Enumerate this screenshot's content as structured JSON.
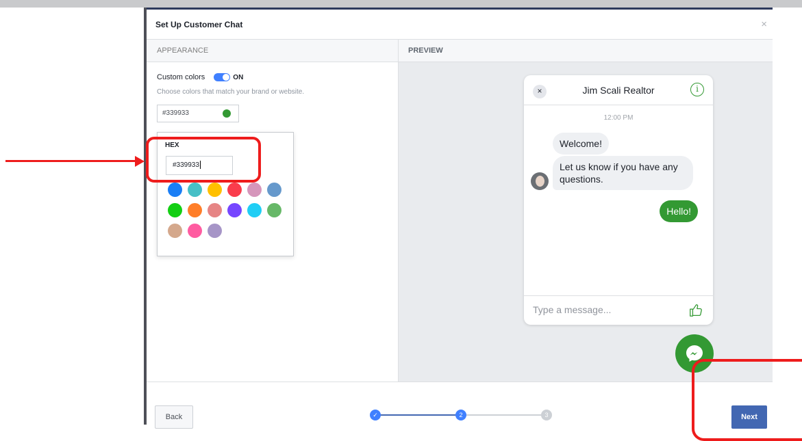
{
  "dialog": {
    "title": "Set Up Customer Chat",
    "close_glyph": "×"
  },
  "appearance": {
    "section_label": "APPEARANCE",
    "custom_colors_label": "Custom colors",
    "toggle_state": "ON",
    "help_text": "Choose colors that match your brand or website.",
    "selected_color_value": "#339933",
    "selected_color": "#339933",
    "picker": {
      "hex_label": "HEX",
      "hex_value": "#339933",
      "swatches": [
        "#1a7ef5",
        "#46bfc6",
        "#ffc000",
        "#fa3c4c",
        "#d696bb",
        "#6699cc",
        "#13cf13",
        "#ff7e29",
        "#e68585",
        "#7646ff",
        "#20cef5",
        "#67b868",
        "#d4a88c",
        "#ff5ca1",
        "#a695c7"
      ]
    }
  },
  "preview": {
    "section_label": "PREVIEW",
    "chat": {
      "close_glyph": "×",
      "page_name": "Jim Scali Realtor",
      "info_glyph": "i",
      "timestamp": "12:00 PM",
      "incoming_messages": [
        "Welcome!",
        "Let us know if you have any questions."
      ],
      "outgoing_message": "Hello!",
      "input_placeholder": "Type a message..."
    }
  },
  "footer": {
    "back_label": "Back",
    "next_label": "Next",
    "steps": [
      {
        "label": "✓",
        "state": "done"
      },
      {
        "label": "2",
        "state": "current"
      },
      {
        "label": "3",
        "state": "pending"
      }
    ]
  },
  "colors": {
    "accent": "#4080ff",
    "primary_button": "#4267b2",
    "chat_theme": "#339933",
    "annotation": "#ee1c1c"
  }
}
